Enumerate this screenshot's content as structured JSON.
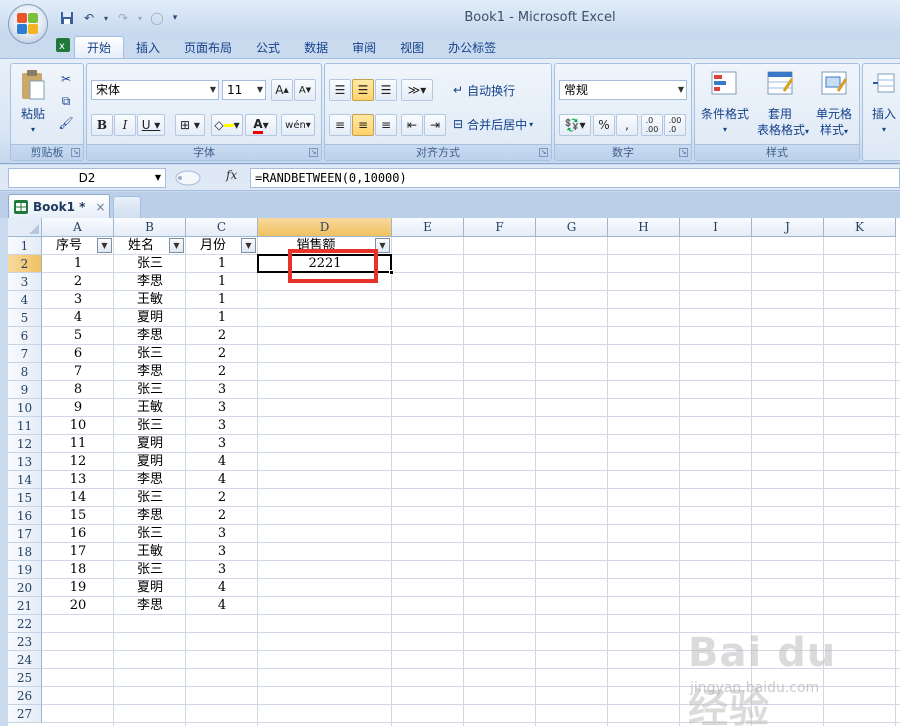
{
  "window": {
    "title": "Book1 - Microsoft Excel"
  },
  "tabs": [
    "开始",
    "插入",
    "页面布局",
    "公式",
    "数据",
    "审阅",
    "视图",
    "办公标签"
  ],
  "ribbon": {
    "clipboard": {
      "label": "剪贴板",
      "paste": "粘贴"
    },
    "font": {
      "label": "字体",
      "name": "宋体",
      "size": "11"
    },
    "alignment": {
      "label": "对齐方式",
      "wrap": "自动换行",
      "merge": "合并后居中"
    },
    "number": {
      "label": "数字",
      "format": "常规"
    },
    "styles": {
      "label": "样式",
      "conditional_1": "条件格式",
      "table_1": "套用",
      "table_2": "表格格式",
      "cell_1": "单元格",
      "cell_2": "样式"
    },
    "cells": {
      "insert": "插入"
    }
  },
  "formula_bar": {
    "name_box": "D2",
    "fx": "fx",
    "formula": "=RANDBETWEEN(0,10000)"
  },
  "workbook_tab": {
    "name": "Book1 *",
    "close": "×"
  },
  "grid": {
    "columns": [
      "A",
      "B",
      "C",
      "D",
      "E",
      "F",
      "G",
      "H",
      "I",
      "J",
      "K"
    ],
    "rows": [
      "1",
      "2",
      "3",
      "4",
      "5",
      "6",
      "7",
      "8",
      "9",
      "10",
      "11",
      "12",
      "13",
      "14",
      "15",
      "16",
      "17",
      "18",
      "19",
      "20",
      "21",
      "22",
      "23",
      "24",
      "25",
      "26",
      "27"
    ],
    "headers": [
      "序号",
      "姓名",
      "月份",
      "销售额"
    ],
    "data": [
      [
        "1",
        "张三",
        "1",
        "2221"
      ],
      [
        "2",
        "李思",
        "1",
        ""
      ],
      [
        "3",
        "王敏",
        "1",
        ""
      ],
      [
        "4",
        "夏明",
        "1",
        ""
      ],
      [
        "5",
        "李思",
        "2",
        ""
      ],
      [
        "6",
        "张三",
        "2",
        ""
      ],
      [
        "7",
        "李思",
        "2",
        ""
      ],
      [
        "8",
        "张三",
        "3",
        ""
      ],
      [
        "9",
        "王敏",
        "3",
        ""
      ],
      [
        "10",
        "张三",
        "3",
        ""
      ],
      [
        "11",
        "夏明",
        "3",
        ""
      ],
      [
        "12",
        "夏明",
        "4",
        ""
      ],
      [
        "13",
        "李思",
        "4",
        ""
      ],
      [
        "14",
        "张三",
        "2",
        ""
      ],
      [
        "15",
        "李思",
        "2",
        ""
      ],
      [
        "16",
        "张三",
        "3",
        ""
      ],
      [
        "17",
        "王敏",
        "3",
        ""
      ],
      [
        "18",
        "张三",
        "3",
        ""
      ],
      [
        "19",
        "夏明",
        "4",
        ""
      ],
      [
        "20",
        "李思",
        "4",
        ""
      ]
    ],
    "active_cell": "D2"
  },
  "watermark": {
    "logo": "Bai du 经验",
    "sub": "jingyan.baidu.com"
  },
  "colors": {
    "highlight": "#e8332a",
    "selected_header": "#f1c15f"
  }
}
